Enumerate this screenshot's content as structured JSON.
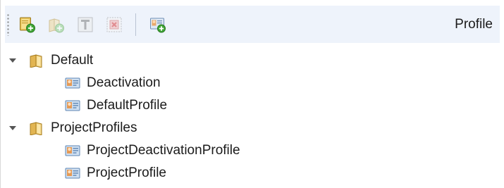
{
  "toolbar": {
    "buttons": [
      {
        "icon": "add-folder-icon",
        "enabled": true
      },
      {
        "icon": "add-subfolder-icon",
        "enabled": false
      },
      {
        "icon": "rename-icon",
        "enabled": false
      },
      {
        "icon": "delete-icon",
        "enabled": false
      },
      {
        "icon": "add-profile-icon",
        "enabled": true
      }
    ],
    "profile_label": "Profile"
  },
  "tree": {
    "folders": [
      {
        "label": "Default",
        "expanded": true,
        "icon": "folder-icon",
        "children": [
          {
            "label": "Deactivation",
            "icon": "profile-icon"
          },
          {
            "label": "DefaultProfile",
            "icon": "profile-icon"
          }
        ]
      },
      {
        "label": "ProjectProfiles",
        "expanded": true,
        "icon": "folder-icon",
        "children": [
          {
            "label": "ProjectDeactivationProfile",
            "icon": "profile-icon"
          },
          {
            "label": "ProjectProfile",
            "icon": "profile-icon"
          }
        ]
      }
    ]
  }
}
